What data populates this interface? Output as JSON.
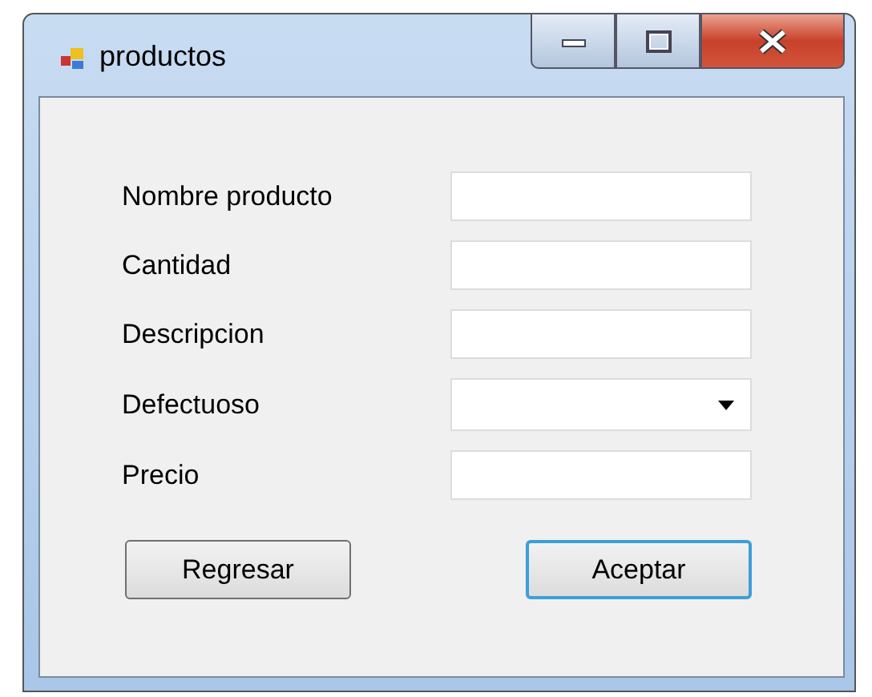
{
  "window": {
    "title": "productos"
  },
  "fields": [
    {
      "label": "Nombre producto",
      "kind": "text"
    },
    {
      "label": "Cantidad",
      "kind": "text"
    },
    {
      "label": "Descripcion",
      "kind": "text"
    },
    {
      "label": "Defectuoso",
      "kind": "dropdown"
    },
    {
      "label": "Precio",
      "kind": "text"
    }
  ],
  "buttons": [
    {
      "label": "Regresar",
      "default": false
    },
    {
      "label": "Aceptar",
      "default": true
    }
  ]
}
